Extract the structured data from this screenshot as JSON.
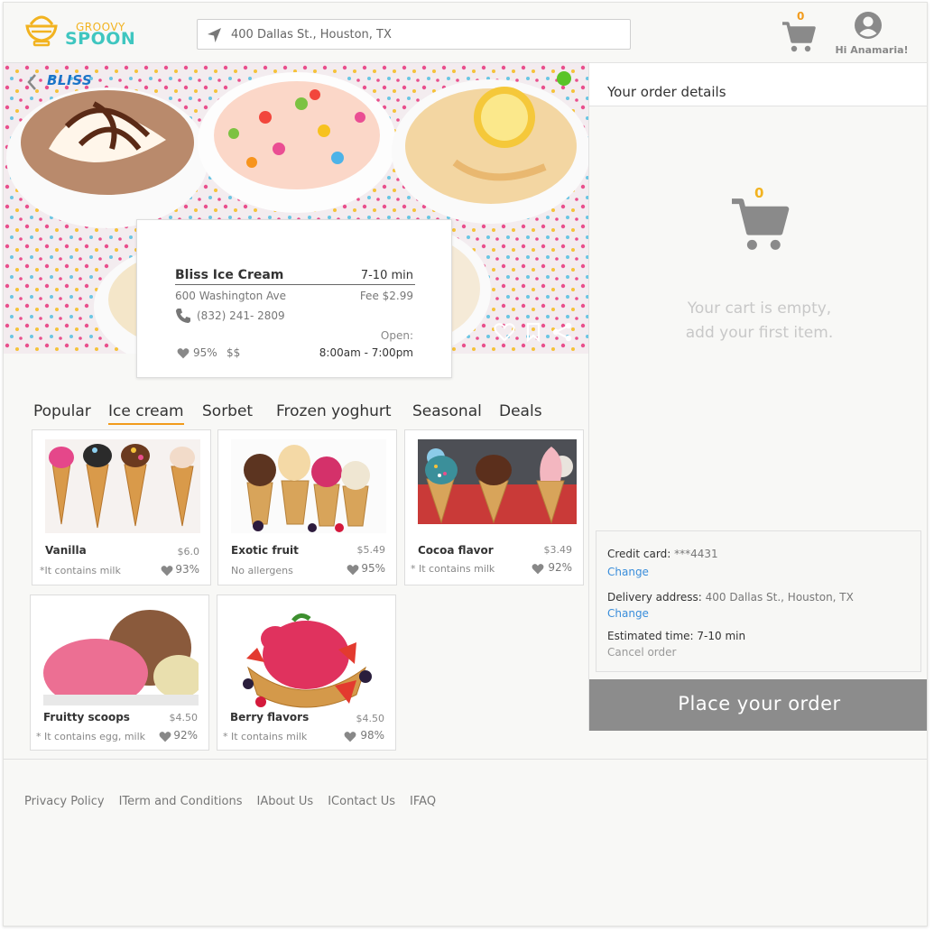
{
  "header": {
    "logo_top": "GROOVY",
    "logo_bottom": "SPOON",
    "search_value": "400 Dallas St., Houston, TX",
    "cart_count": "0",
    "user_greeting": "Hi Anamaria!"
  },
  "restaurant": {
    "brand": "BLISS",
    "name": "Bliss Ice Cream",
    "delivery_time": "7-10 min",
    "address": "600 Washington Ave",
    "fee": "Fee $2.99",
    "phone": "(832) 241- 2809",
    "open_label": "Open:",
    "hours": "8:00am - 7:00pm",
    "rating": "95%",
    "price_level": "$$"
  },
  "tabs": [
    {
      "label": "Popular",
      "active": false
    },
    {
      "label": "Ice cream",
      "active": true
    },
    {
      "label": "Sorbet",
      "active": false
    },
    {
      "label": "Frozen yoghurt",
      "active": false
    },
    {
      "label": "Seasonal",
      "active": false
    },
    {
      "label": "Deals",
      "active": false
    }
  ],
  "products": [
    {
      "name": "Vanilla",
      "price": "$6.0",
      "note": "*It contains milk",
      "rating": "93%"
    },
    {
      "name": "Exotic fruit",
      "price": "$5.49",
      "note": "No allergens",
      "rating": "95%"
    },
    {
      "name": "Cocoa flavor",
      "price": "$3.49",
      "note": "* It contains milk",
      "rating": "92%"
    },
    {
      "name": "Fruitty scoops",
      "price": "$4.50",
      "note": "* It contains egg, milk",
      "rating": "92%"
    },
    {
      "name": "Berry flavors",
      "price": "$4.50",
      "note": "* It contains milk",
      "rating": "98%"
    }
  ],
  "order": {
    "title": "Your order details",
    "cart_count": "0",
    "empty_line1": "Your cart is empty,",
    "empty_line2": "add your first item.",
    "credit_label": "Credit card:",
    "credit_value": "***4431",
    "change1": "Change",
    "address_label": "Delivery address:",
    "address_value": "400 Dallas St., Houston, TX",
    "change2": "Change",
    "time_label": "Estimated time:",
    "time_value": "7-10 min",
    "cancel": "Cancel order",
    "place_button": "Place your order"
  },
  "footer": {
    "links": [
      "Privacy Policy",
      "Term and Conditions",
      "About Us",
      "Contact Us",
      "FAQ"
    ],
    "separator": "I"
  },
  "colors": {
    "accent_orange": "#f29b1c",
    "logo_teal": "#3fc6c0",
    "link_blue": "#3a8edb",
    "status_green": "#5ac428",
    "button_gray": "#8c8c8c"
  }
}
